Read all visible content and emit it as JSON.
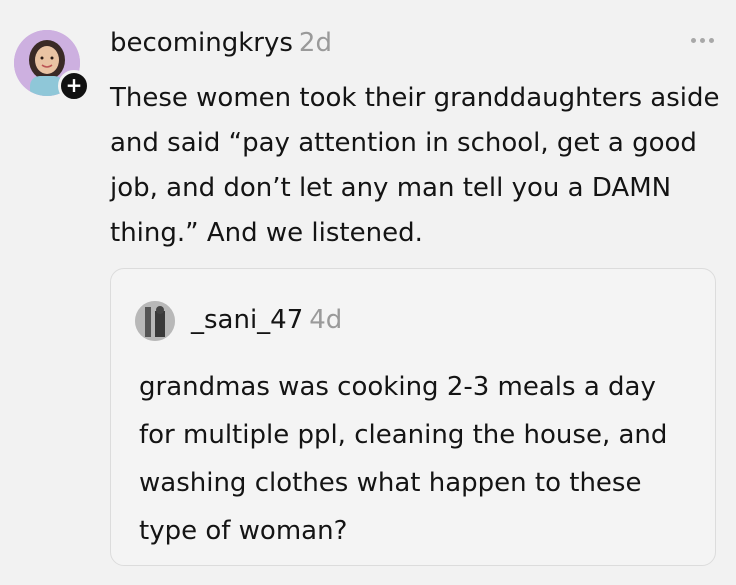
{
  "post": {
    "username": "becomingkrys",
    "timestamp": "2d",
    "text": "These women took their granddaughters aside and said “pay attention in school, get a good job, and don’t let any man tell you a DAMN thing.” And we listened."
  },
  "quote": {
    "username": "_sani_47",
    "timestamp": "4d",
    "text": "grandmas was cooking 2-3 meals a day for multiple ppl, cleaning the house, and washing clothes what happen to these type of woman?"
  },
  "follow_badge": "+",
  "icons": {
    "more": "more-horizontal-icon",
    "follow": "plus-icon"
  },
  "colors": {
    "background": "#f2f2f2",
    "text": "#141414",
    "muted": "#9a9a9a",
    "card_border": "#dcdcdc"
  }
}
